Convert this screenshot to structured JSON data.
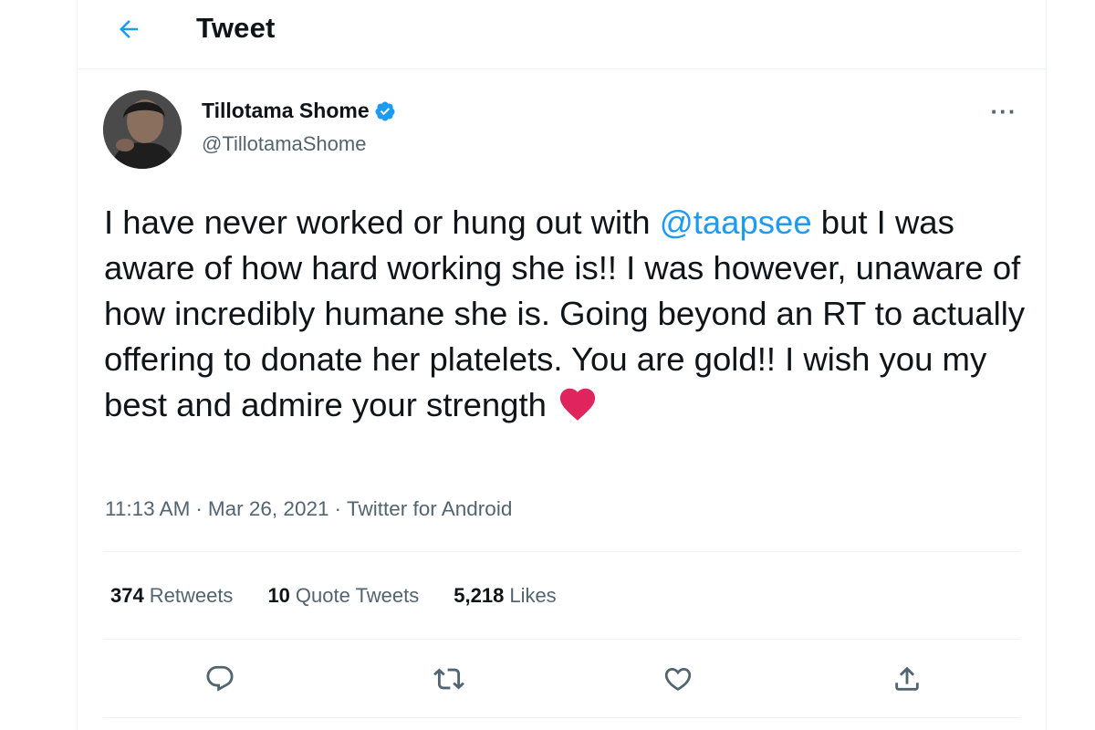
{
  "header": {
    "title": "Tweet",
    "back_icon": "arrow-left-icon"
  },
  "tweet": {
    "author": {
      "display_name": "Tillotama Shome",
      "handle": "@TillotamaShome",
      "verified": true
    },
    "text_parts": {
      "p1": "I have never worked or hung out with ",
      "mention": "@taapsee",
      "p2": " but I was aware of how hard working she is!! I was however, unaware of how incredibly humane she is. Going beyond an RT to actually offering to donate her platelets. You are gold!! I wish you my best and admire your strength"
    },
    "emoji": "red-heart",
    "time": "11:13 AM",
    "date": "Mar 26, 2021",
    "separator": "·",
    "source": "Twitter for Android",
    "more_label": "···"
  },
  "stats": [
    {
      "count": "374",
      "label": "Retweets"
    },
    {
      "count": "10",
      "label": "Quote Tweets"
    },
    {
      "count": "5,218",
      "label": "Likes"
    }
  ],
  "actions": [
    "reply-icon",
    "retweet-icon",
    "like-icon",
    "share-icon"
  ],
  "colors": {
    "accent": "#1d9bf0",
    "text": "#0f1419",
    "secondary": "#536471",
    "heart": "#e0245e",
    "border": "#eff3f4"
  }
}
